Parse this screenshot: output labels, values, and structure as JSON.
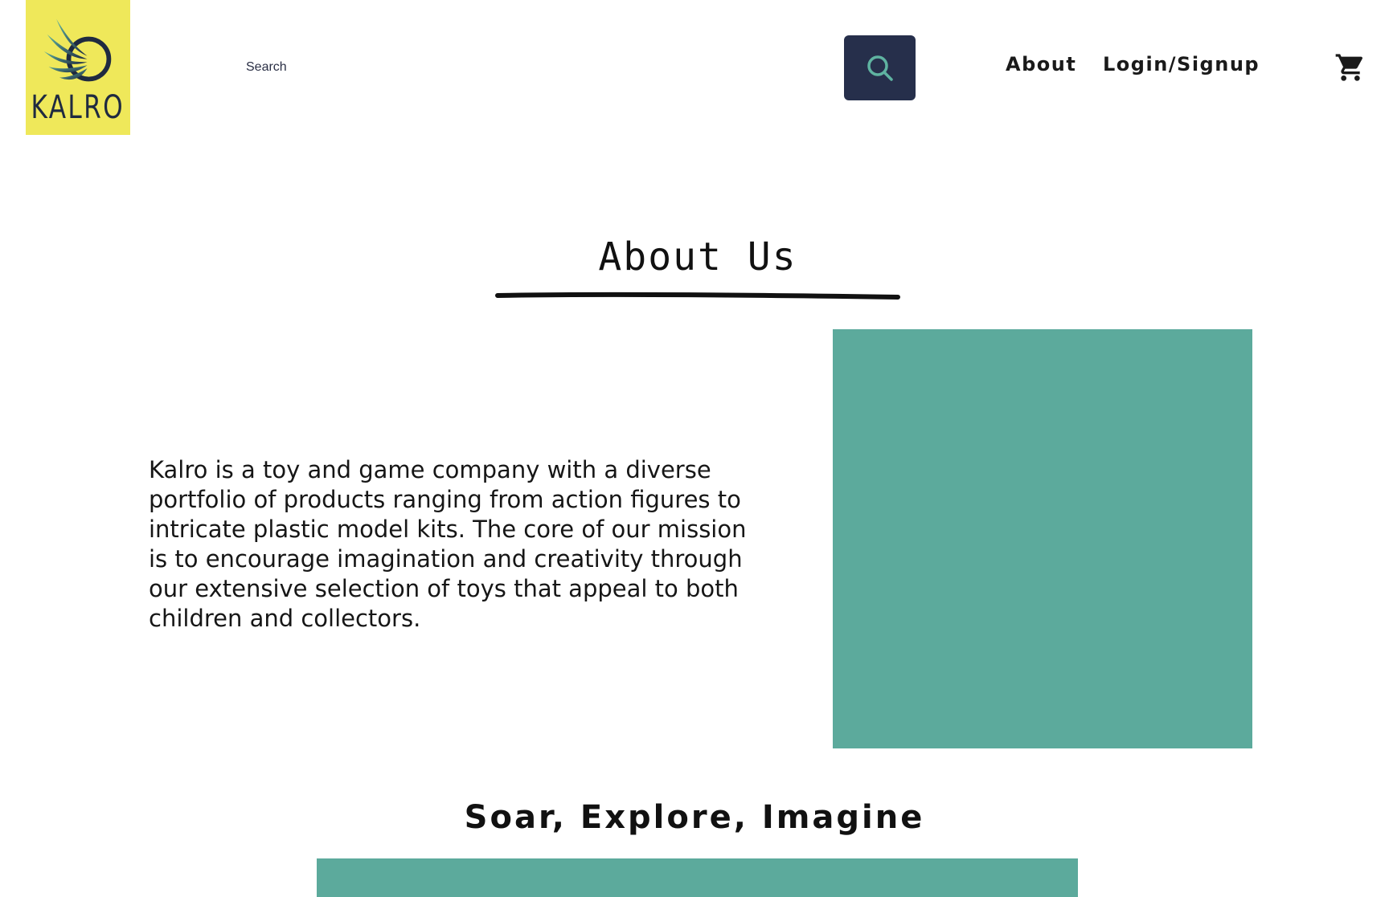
{
  "header": {
    "logo_text": "KALRO",
    "search": {
      "placeholder": "Search"
    },
    "nav": {
      "about_label": "About",
      "login_label": "Login/Signup"
    }
  },
  "icons": {
    "logo": "wing-circle-icon",
    "search": "search-icon",
    "cart": "cart-icon"
  },
  "main": {
    "title": "About Us",
    "description": "Kalro is a toy and game company with a diverse portfolio of products ranging from action figures to intricate plastic model kits. The core of our mission is to encourage imagination and creativity through our extensive selection of toys that appeal to both children and collectors.",
    "tagline": "Soar, Explore, Imagine"
  },
  "colors": {
    "logo_background": "#efe85a",
    "search_button": "#262f4b",
    "image_placeholder": "#5caa9c",
    "text": "#111111"
  }
}
